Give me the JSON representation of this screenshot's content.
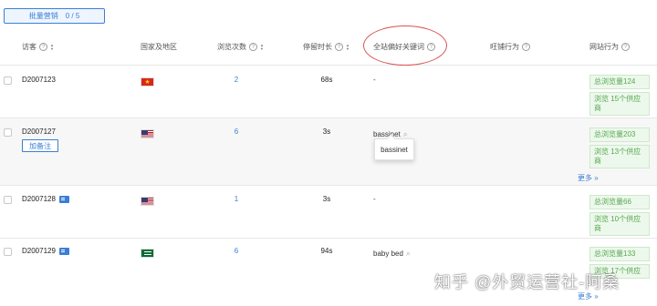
{
  "bulk_button": {
    "label": "批量营销",
    "count": "0 / 5"
  },
  "columns": {
    "visitor": "访客",
    "country": "国家及地区",
    "views": "浏览次数",
    "duration": "停留时长",
    "keyword": "全站偏好关键词",
    "shop_behavior": "旺铺行为",
    "site_behavior": "网站行为"
  },
  "rows": [
    {
      "id": "D2007123",
      "country": "Vietnam",
      "views": "2",
      "duration": "68s",
      "keyword": "-",
      "tags": [
        "总浏览量124",
        "浏览 15个供应商"
      ]
    },
    {
      "id": "D2007127",
      "country": "United States",
      "views": "6",
      "duration": "3s",
      "keyword": "bassinet",
      "add_note": "加备注",
      "tags": [
        "总浏览量203",
        "浏览 13个供应商"
      ],
      "more": "更多"
    },
    {
      "id": "D2007128",
      "country": "United States",
      "views": "1",
      "duration": "3s",
      "keyword": "-",
      "tags": [
        "总浏览量66",
        "浏览 10个供应商"
      ]
    },
    {
      "id": "D2007129",
      "country": "Saudi Arabia",
      "views": "6",
      "duration": "94s",
      "keyword": "baby bed",
      "tags": [
        "总浏览量133",
        "浏览 17个供应"
      ],
      "more": "更多"
    }
  ],
  "tooltip": "bassinet",
  "watermark": "知乎 @外贸运营社-阿桑",
  "colors": {
    "accent": "#3a7fd5",
    "tag_text": "#55a84f",
    "tag_bg": "#edf8ec",
    "highlight_circle": "#d9534f"
  }
}
